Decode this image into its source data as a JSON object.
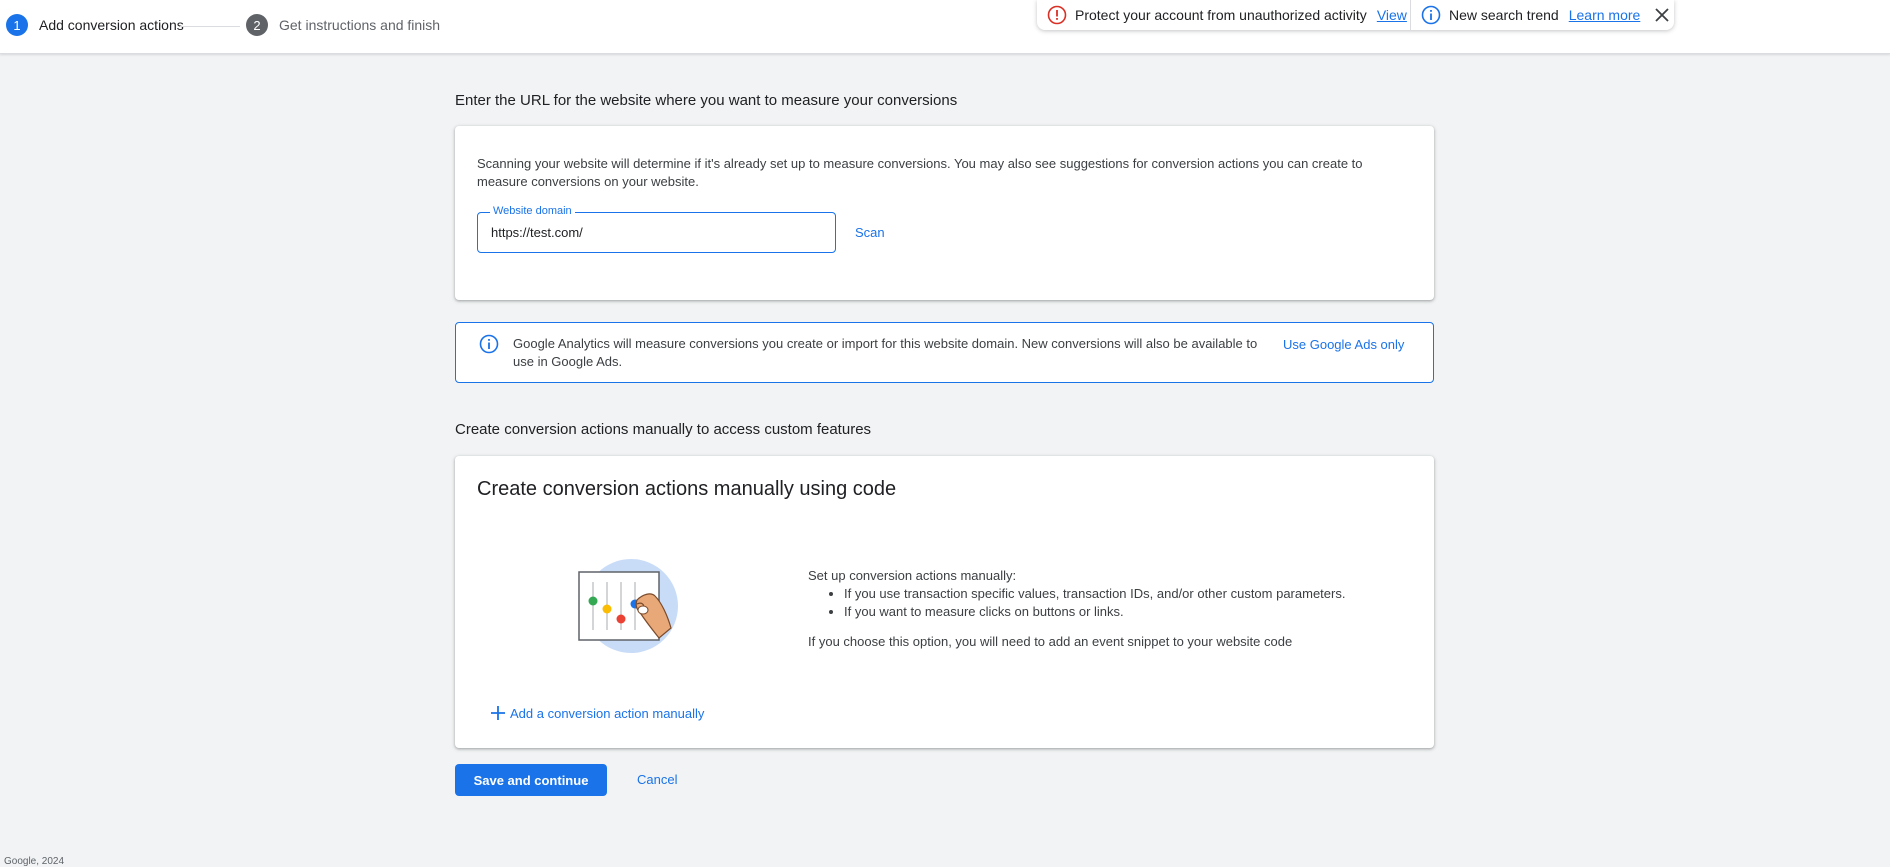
{
  "stepper": {
    "step1": {
      "num": "1",
      "label": "Add conversion actions"
    },
    "step2": {
      "num": "2",
      "label": "Get instructions and finish"
    }
  },
  "notifications": {
    "alert": {
      "text": "Protect your account from unauthorized activity",
      "link": "View",
      "icon": "error-icon"
    },
    "trend": {
      "text": "New search trend",
      "link": "Learn more",
      "icon": "info-icon"
    },
    "close_icon": "close-icon"
  },
  "website_section": {
    "title": "Enter the URL for the website where you want to measure your conversions",
    "description": "Scanning your website will determine if it's already set up to measure conversions. You may also see suggestions for conversion actions you can create to measure conversions on your website.",
    "field_label": "Website domain",
    "field_value": "https://test.com/",
    "scan_label": "Scan"
  },
  "info_banner": {
    "text": "Google Analytics will measure conversions you create or import for this website domain. New conversions will also be available to use in Google Ads.",
    "action": "Use Google Ads only"
  },
  "manual_section": {
    "title": "Create conversion actions manually to access custom features",
    "card_heading": "Create conversion actions manually using code",
    "intro": "Set up conversion actions manually:",
    "bullets": [
      "If you use transaction specific values, transaction IDs, and/or other custom parameters.",
      "If you want to measure clicks on buttons or links."
    ],
    "note": "If you choose this option, you will need to add an event snippet to your website code",
    "add_link": "Add a conversion action manually"
  },
  "actions": {
    "save": "Save and continue",
    "cancel": "Cancel"
  },
  "footer": "Google, 2024",
  "colors": {
    "accent": "#1a73e8",
    "error": "#d93025",
    "background": "#f1f3f4"
  }
}
